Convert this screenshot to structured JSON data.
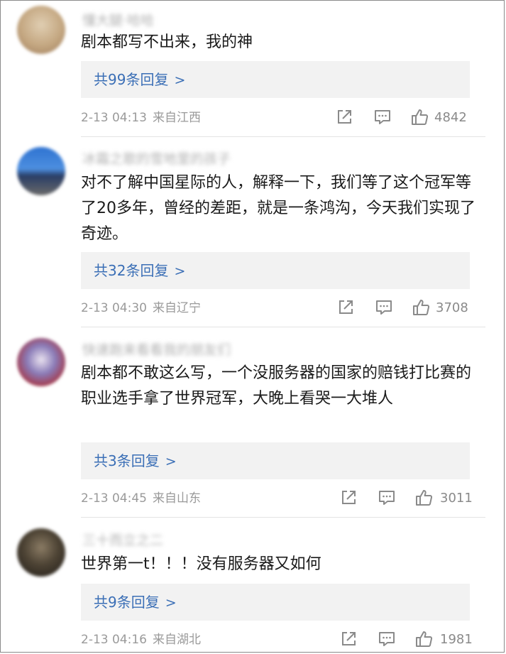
{
  "comments": [
    {
      "nickname": "懂大腿·哈哈",
      "text": "剧本都写不出来，我的神",
      "replies_label": "共99条回复",
      "time": "2-13 04:13",
      "source": "来自江西",
      "likes": "4842",
      "avatar_colors": [
        "#d9c7ac",
        "#a78665"
      ]
    },
    {
      "nickname": "冰霜之歌的雪地里的孩子",
      "text": "对不了解中国星际的人，解释一下，我们等了这个冠军等了20多年，曾经的差距，就是一条鸿沟，今天我们实现了奇迹。",
      "replies_label": "共32条回复",
      "time": "2-13 04:30",
      "source": "来自辽宁",
      "likes": "3708",
      "avatar_colors": [
        "#3d7fd6",
        "#1d3a6a"
      ]
    },
    {
      "nickname": "快速跑来看看我的朋友们",
      "text": "剧本都不敢这么写，一个没服务器的国家的赔钱打比赛的职业选手拿了世界冠军，大晚上看哭一大堆人",
      "replies_label": "共3条回复",
      "time": "2-13 04:45",
      "source": "来自山东",
      "likes": "3011",
      "avatar_colors": [
        "#b7a6c9",
        "#7a3b47"
      ]
    },
    {
      "nickname": "三十而立之二",
      "text": "世界第一t！！！没有服务器又如何",
      "replies_label": "共9条回复",
      "time": "2-13 04:16",
      "source": "来自湖北",
      "likes": "1981",
      "avatar_colors": [
        "#5a4b3a",
        "#1d1a16"
      ]
    }
  ],
  "chevron": ">",
  "icons": {
    "share": "share-icon",
    "comment": "comment-icon",
    "like": "thumbs-up-icon"
  },
  "colors": {
    "link": "#3b6fb6",
    "meta": "#9a9a9a",
    "text": "#1a1a1a",
    "reply_bg": "#f2f2f2"
  }
}
